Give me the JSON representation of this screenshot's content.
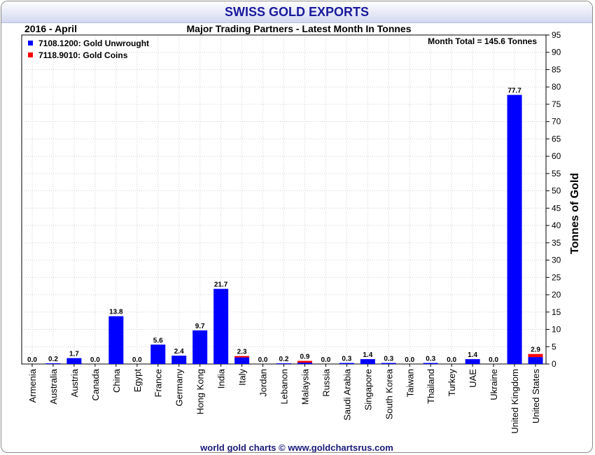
{
  "header": {
    "title": "SWISS GOLD EXPORTS",
    "period": "2016 - April",
    "subtitle": "Major Trading Partners - Latest Month In Tonnes"
  },
  "footer": {
    "credit": "world gold charts © www.goldchartsrus.com"
  },
  "chart_data": {
    "type": "bar",
    "stacked": true,
    "title": "Major Trading Partners - Latest Month In Tonnes",
    "ylabel": "Tonnes of Gold",
    "xlabel": "",
    "ylim": [
      0,
      95
    ],
    "yticks": [
      0,
      5,
      10,
      15,
      20,
      25,
      30,
      35,
      40,
      45,
      50,
      55,
      60,
      65,
      70,
      75,
      80,
      85,
      90,
      95
    ],
    "y_axis_side": "right",
    "grid": true,
    "legend_position": "top-left",
    "annotation": "Month Total = 145.6 Tonnes",
    "categories": [
      "Armenia",
      "Australia",
      "Austria",
      "Canada",
      "China",
      "Egypt",
      "France",
      "Germany",
      "Hong Kong",
      "India",
      "Italy",
      "Jordan",
      "Lebanon",
      "Malaysia",
      "Russia",
      "Saudi Arabia",
      "Singapore",
      "South Korea",
      "Taiwan",
      "Thailand",
      "Turkey",
      "UAE",
      "Ukraine",
      "United Kingdom",
      "United States"
    ],
    "totals": [
      "0.0",
      "0.2",
      "1.7",
      "0.0",
      "13.8",
      "0.0",
      "5.6",
      "2.4",
      "9.7",
      "21.7",
      "2.3",
      "0.0",
      "0.2",
      "0.9",
      "0.0",
      "0.3",
      "1.4",
      "0.3",
      "0.0",
      "0.3",
      "0.0",
      "1.4",
      "0.0",
      "77.7",
      "2.9"
    ],
    "series": [
      {
        "name": "7108.1200: Gold Unwrought",
        "color": "#0000ff",
        "values": [
          0,
          0.2,
          1.7,
          0,
          13.8,
          0,
          5.6,
          2.4,
          9.7,
          21.7,
          1.9,
          0,
          0.2,
          0.4,
          0,
          0.3,
          1.4,
          0.3,
          0,
          0.3,
          0,
          1.4,
          0,
          77.7,
          2.0
        ]
      },
      {
        "name": "7118.9010: Gold Coins",
        "color": "#ff0000",
        "values": [
          0,
          0,
          0,
          0,
          0,
          0,
          0,
          0,
          0,
          0,
          0.4,
          0,
          0,
          0.5,
          0,
          0,
          0,
          0,
          0,
          0,
          0,
          0,
          0,
          0,
          0.9
        ]
      }
    ]
  }
}
